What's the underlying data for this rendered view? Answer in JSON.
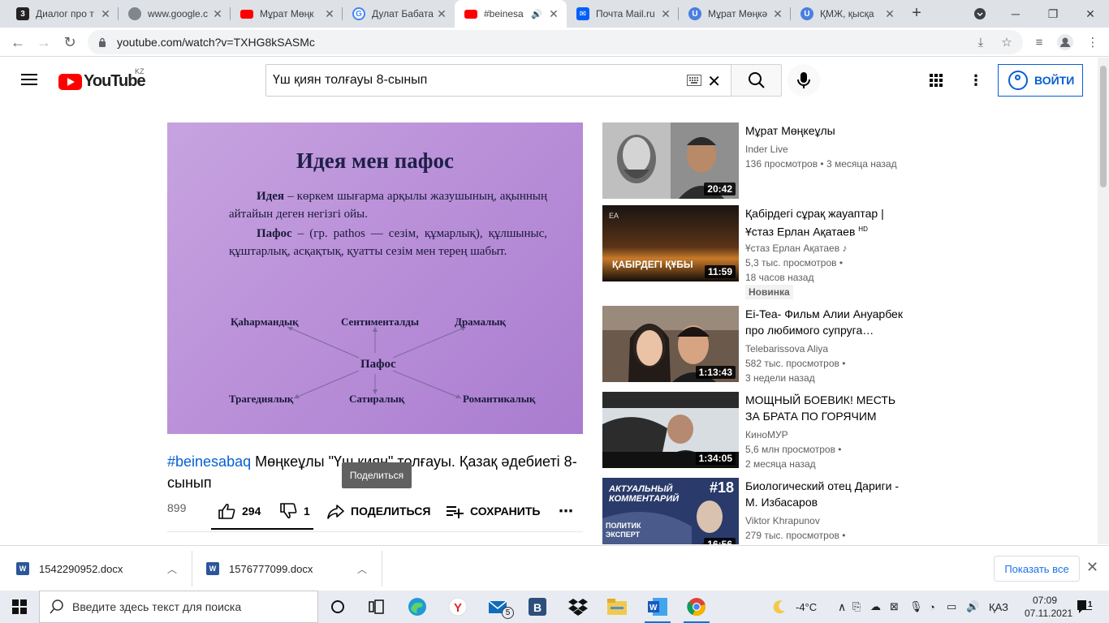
{
  "browser": {
    "tabs": [
      {
        "title": "Диалог про т",
        "favicon": "3"
      },
      {
        "title": "www.google.c",
        "favicon": "globe"
      },
      {
        "title": "Мұрат Мөңк",
        "favicon": "youtube"
      },
      {
        "title": "Дулат Бабата",
        "favicon": "google"
      },
      {
        "title": "#beinesa",
        "favicon": "youtube"
      },
      {
        "title": "Почта Mail.ru",
        "favicon": "mail"
      },
      {
        "title": "Мұрат Мөңкә",
        "favicon": "u"
      },
      {
        "title": "ҚМЖ, қысқа",
        "favicon": "u"
      }
    ],
    "url": "youtube.com/watch?v=TXHG8kSASMc"
  },
  "youtube": {
    "logo_text": "YouTube",
    "country_code": "KZ",
    "search_query": "Үш қиян толғауы 8-сынып",
    "signin_label": "ВОЙТИ"
  },
  "video": {
    "slide": {
      "title": "Идея мен пафос",
      "idea_term": "Идея",
      "idea_text": " – көркем шығарма арқылы жазушының, ақынның айтайын деген  негізгі ойы.",
      "pathos_term": "Пафос",
      "pathos_text": " – (гр. pathos — сезім, құмарлық), құлшыныс, құштарлық, асқақтық, қуатты сезім мен терең шабыт.",
      "center_node": "Пафос",
      "nodes": [
        "Қаһармандық",
        "Сентименталды",
        "Драмалық",
        "Трагедиялық",
        "Сатиралық",
        "Романтикалық"
      ]
    },
    "hashtag": "#beinesabaq",
    "title_rest": " Мөңкеұлы \"Үш қиян\" толғауы. Қазақ әдебиеті 8-сынып",
    "views": "899",
    "likes": "294",
    "dislikes": "1",
    "share_label": "ПОДЕЛИТЬСЯ",
    "save_label": "СОХРАНИТЬ",
    "tooltip": "Поделиться"
  },
  "recommendations": [
    {
      "title": "Мұрат Мөңкеұлы",
      "channel": "Inder Live",
      "stats": "136 просмотров • 3 месяца назад",
      "stats2": "",
      "duration": "20:42",
      "badge": ""
    },
    {
      "title": "Қабірдегі сұрақ жауаптар | Ұстаз Ерлан Ақатаев",
      "title_suffix": "HD",
      "channel": "Ұстаз Ерлан Ақатаев",
      "stats": "5,3 тыс. просмотров •",
      "stats2": "18 часов назад",
      "duration": "11:59",
      "badge": "Новинка",
      "thumb_text": "ҚАБІРДЕГІ ҚҰБЫ"
    },
    {
      "title": "Ei-Tea- Фильм Алии Ануарбек про любимого супруга…",
      "channel": "Telebarissova Aliya",
      "stats": "582 тыс. просмотров •",
      "stats2": "3 недели назад",
      "duration": "1:13:43",
      "badge": ""
    },
    {
      "title": "МОЩНЫЙ БОЕВИК! МЕСТЬ ЗА БРАТА ПО ГОРЯЧИМ СЛЕДА…",
      "channel": "КиноМУР",
      "stats": "5,6 млн просмотров •",
      "stats2": "2 месяца назад",
      "duration": "1:34:05",
      "badge": ""
    },
    {
      "title": "Биологический отец Дариги - М. Избасаров",
      "channel": "Viktor Khrapunov",
      "stats": "279 тыс. просмотров •",
      "stats2": "",
      "duration": "16:56",
      "badge": "",
      "thumb_text": "АКТУАЛЬНЫЙ КОММЕНТАРИЙ",
      "thumb_num": "#18",
      "thumb_text2": "ПОЛИТИК ЭКСПЕРТ"
    }
  ],
  "downloads": {
    "files": [
      "1542290952.docx",
      "1576777099.docx"
    ],
    "show_all": "Показать все"
  },
  "taskbar": {
    "search_placeholder": "Введите здесь текст для поиска",
    "mail_badge": "5",
    "temperature": "-4°C",
    "language": "ҚАЗ",
    "time": "07:09",
    "date": "07.11.2021",
    "notification_count": "1"
  }
}
